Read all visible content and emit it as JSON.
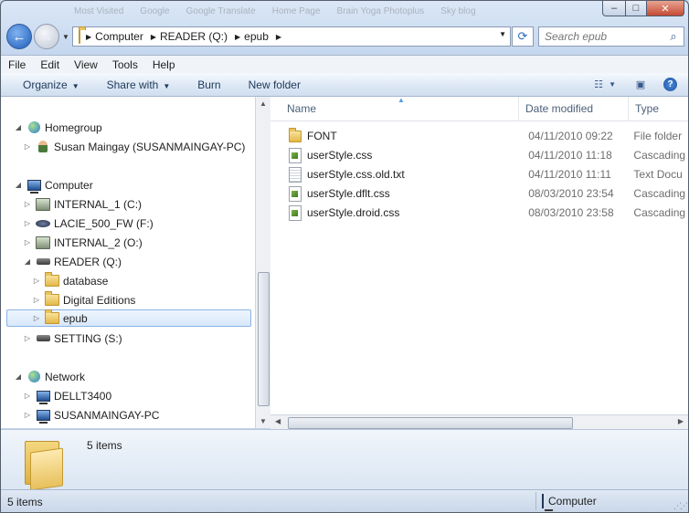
{
  "ghost_tabs": [
    "Most Visited",
    "Google",
    "Google Translate",
    "Home Page",
    "Brain Yoga Photoplus",
    "Sky blog"
  ],
  "icons": {
    "back": "back-arrow-icon",
    "forward": "forward-arrow-icon",
    "refresh": "refresh-icon",
    "search": "magnifier-icon",
    "help": "help-icon",
    "views": "views-icon",
    "preview": "preview-pane-icon"
  },
  "address": {
    "crumbs": [
      "Computer",
      "READER (Q:)",
      "epub"
    ]
  },
  "search": {
    "placeholder": "Search epub"
  },
  "menubar": {
    "file": "File",
    "edit": "Edit",
    "view": "View",
    "tools": "Tools",
    "help": "Help"
  },
  "command_bar": {
    "organize": "Organize",
    "share_with": "Share with",
    "burn": "Burn",
    "new_folder": "New folder"
  },
  "nav_pane": {
    "homegroup": "Homegroup",
    "homegroup_user": "Susan Maingay (SUSANMAINGAY-PC)",
    "computer": "Computer",
    "drives": [
      {
        "label": "INTERNAL_1 (C:)",
        "icon": "hard-drive-icon"
      },
      {
        "label": "LACIE_500_FW (F:)",
        "icon": "external-drive-icon"
      },
      {
        "label": "INTERNAL_2 (O:)",
        "icon": "hard-drive-icon"
      },
      {
        "label": "READER (Q:)",
        "icon": "removable-drive-icon"
      }
    ],
    "reader_folders": [
      "database",
      "Digital Editions",
      "epub"
    ],
    "setting_drive": "SETTING (S:)",
    "network": "Network",
    "network_items": [
      "DELLT3400",
      "SUSANMAINGAY-PC"
    ]
  },
  "file_list": {
    "columns": {
      "name": "Name",
      "date": "Date modified",
      "type": "Type"
    },
    "rows": [
      {
        "name": "FONT",
        "date": "04/11/2010 09:22",
        "type": "File folder",
        "icon": "folder-icon"
      },
      {
        "name": "userStyle.css",
        "date": "04/11/2010 11:18",
        "type": "Cascading",
        "icon": "css-file-icon"
      },
      {
        "name": "userStyle.css.old.txt",
        "date": "04/11/2010 11:11",
        "type": "Text Docu",
        "icon": "text-file-icon"
      },
      {
        "name": "userStyle.dflt.css",
        "date": "08/03/2010 23:54",
        "type": "Cascading",
        "icon": "css-file-icon"
      },
      {
        "name": "userStyle.droid.css",
        "date": "08/03/2010 23:58",
        "type": "Cascading",
        "icon": "css-file-icon"
      }
    ]
  },
  "details_pane": {
    "count": "5 items"
  },
  "status_bar": {
    "left": "5 items",
    "right": "Computer"
  }
}
